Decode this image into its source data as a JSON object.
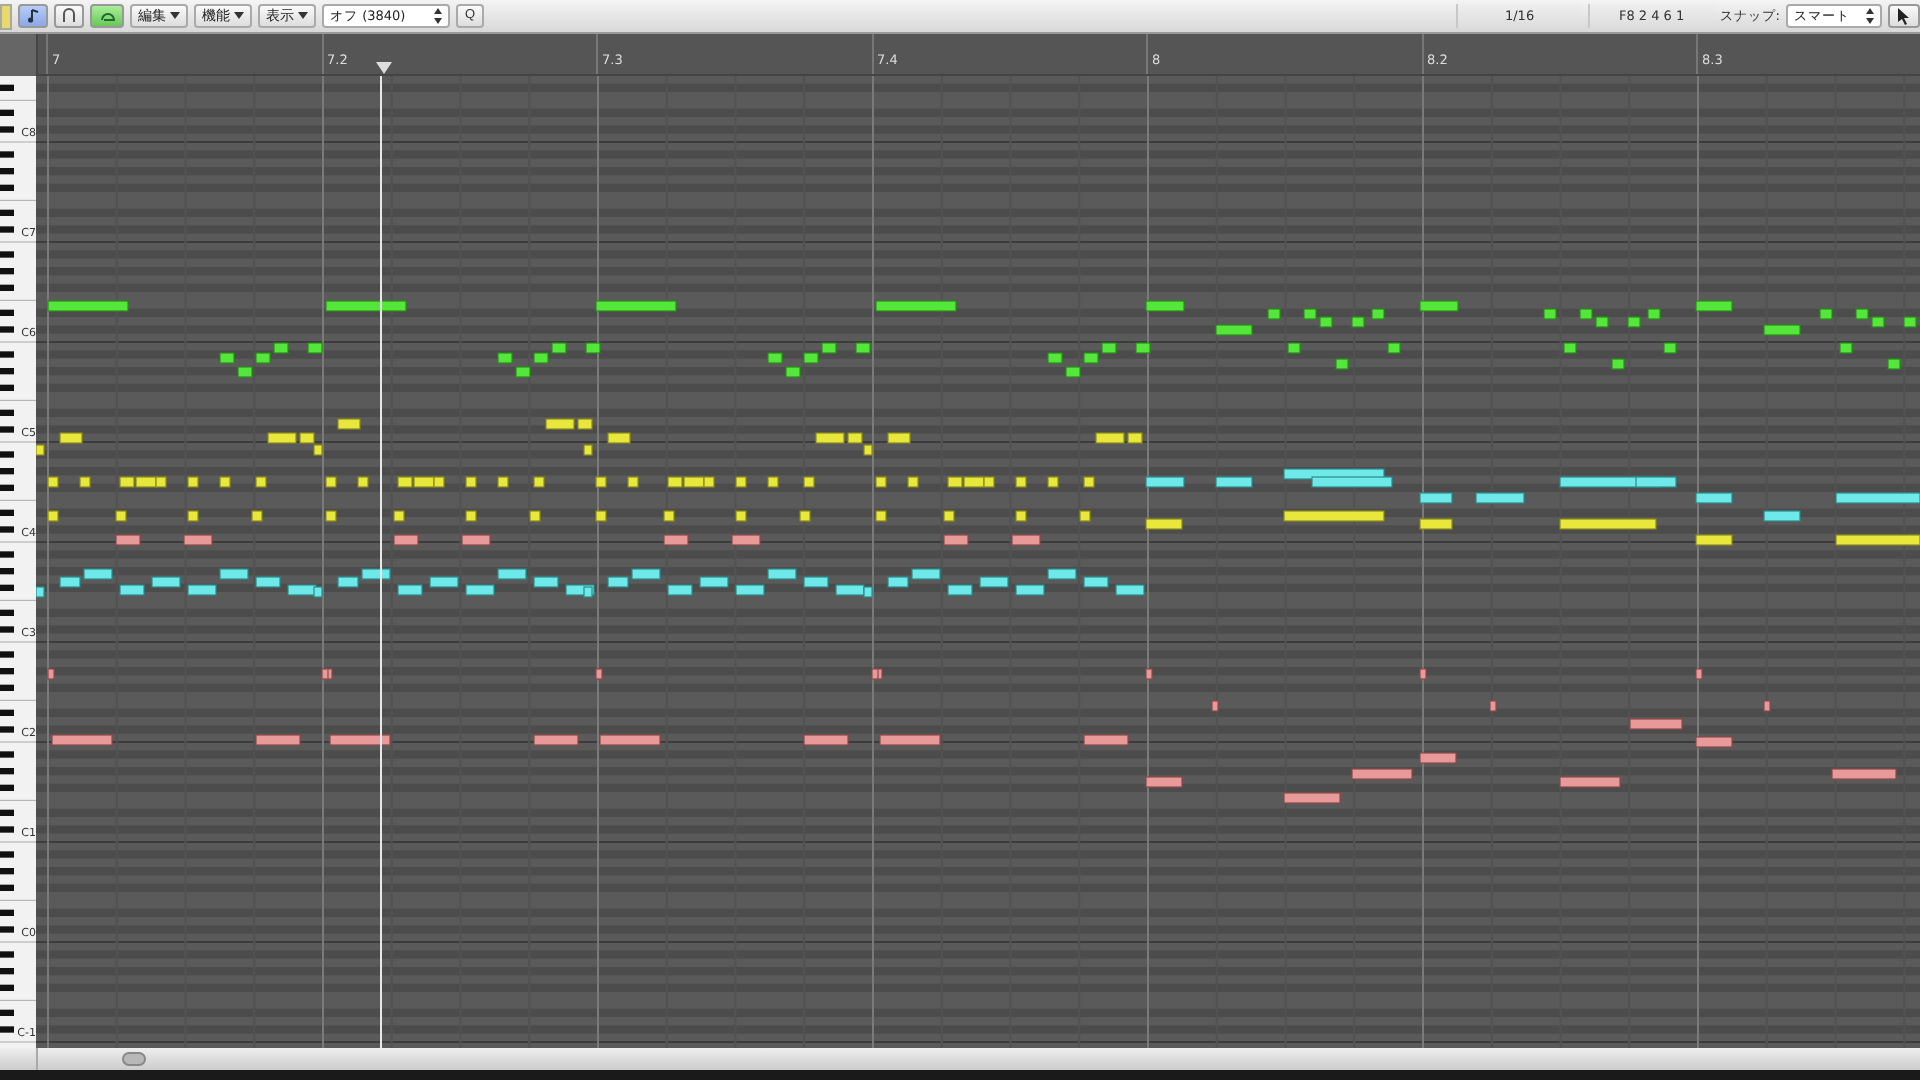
{
  "toolbar": {
    "menus": [
      {
        "label": "編集"
      },
      {
        "label": "機能"
      },
      {
        "label": "表示"
      }
    ],
    "quantize": {
      "value": "オフ (3840)"
    },
    "quantize_button": "Q",
    "division": "1/16",
    "position": "F8  2 4 6 1",
    "snap": {
      "label": "スナップ:",
      "value": "スマート"
    }
  },
  "ruler": {
    "labels": [
      "7",
      "7.2",
      "7.3",
      "7.4",
      "8",
      "8.2",
      "8.3"
    ]
  },
  "keyboard": {
    "labels": [
      "C8",
      "C7",
      "C6",
      "C5",
      "C4",
      "C3",
      "C2",
      "C1",
      "C0",
      "C-1"
    ]
  }
}
